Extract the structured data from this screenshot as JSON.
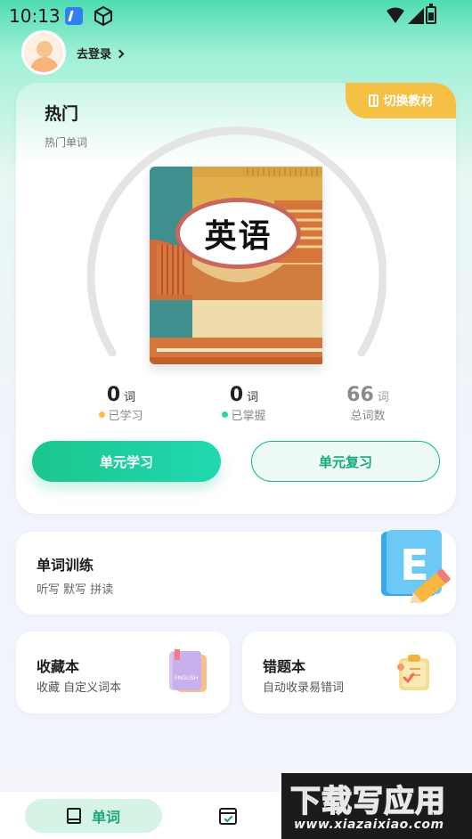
{
  "status_bar": {
    "time": "10:13"
  },
  "header": {
    "login_label": "去登录"
  },
  "main_card": {
    "switch_label": "切换教材",
    "title": "热门",
    "subtitle": "热门单词",
    "book_title": "英语",
    "stats": [
      {
        "value": "0",
        "unit": "词",
        "label": "已学习",
        "dot_color": "#f6c045"
      },
      {
        "value": "0",
        "unit": "词",
        "label": "已掌握",
        "dot_color": "#2dd3a3"
      },
      {
        "value": "66",
        "unit": "词",
        "label": "总词数"
      }
    ],
    "learn_button": "单元学习",
    "review_button": "单元复习"
  },
  "training": {
    "title": "单词训练",
    "subtitle": "听写 默写 拼读"
  },
  "favorites": {
    "title": "收藏本",
    "subtitle": "收藏 自定义词本"
  },
  "mistakes": {
    "title": "错题本",
    "subtitle": "自动收录易错词"
  },
  "tabbar": {
    "active_label": "单词"
  },
  "watermark": {
    "big": "下载写应用",
    "small": "www.xiazaixiao.com"
  },
  "colors": {
    "accent": "#1cc58d",
    "yellow": "#f6c045"
  }
}
